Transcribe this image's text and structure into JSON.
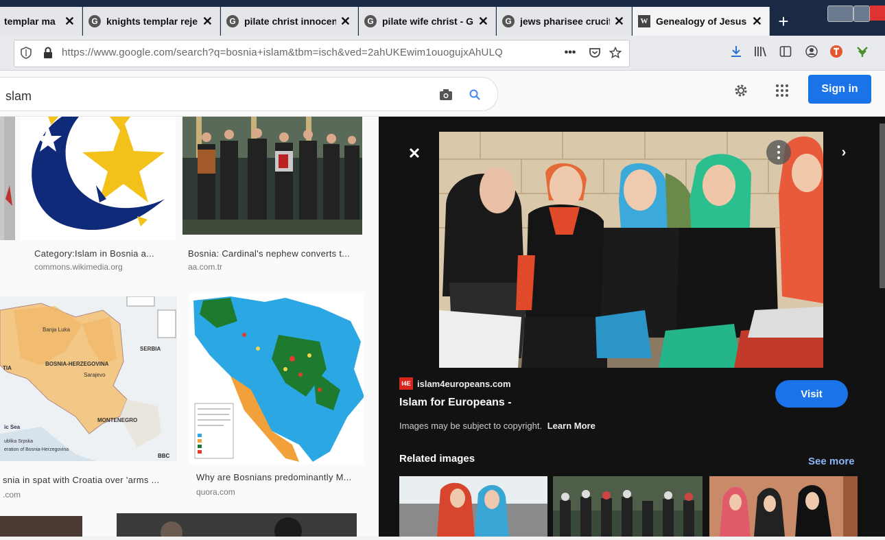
{
  "tabs": [
    {
      "title": "templar ma",
      "icon": "google-icon",
      "active": false
    },
    {
      "title": "knights templar reje",
      "icon": "google-icon",
      "active": false
    },
    {
      "title": "pilate christ innocen",
      "icon": "google-icon",
      "active": false
    },
    {
      "title": "pilate wife christ - G",
      "icon": "google-icon",
      "active": false
    },
    {
      "title": "jews pharisee crucif",
      "icon": "google-icon",
      "active": false
    },
    {
      "title": "Genealogy of Jesus -",
      "icon": "wikipedia-icon",
      "active": true
    }
  ],
  "new_tab": "+",
  "close_glyph": "✕",
  "address_bar": {
    "url": "https://www.google.com/search?q=bosnia+islam&tbm=isch&ved=2ahUKEwim1ouogujxAhULQ",
    "more": "•••"
  },
  "search": {
    "query": "slam"
  },
  "header": {
    "sign_in": "Sign in"
  },
  "results": [
    {
      "caption": "Category:Islam in Bosnia a...",
      "source": "commons.wikimedia.org"
    },
    {
      "caption": "Bosnia: Cardinal's nephew converts t...",
      "source": "aa.com.tr"
    },
    {
      "caption": "snia in spat with Croatia over 'arms ...",
      "source": ".com"
    },
    {
      "caption": "Why are Bosnians predominantly M...",
      "source": "quora.com"
    }
  ],
  "map_labels": {
    "banja_luka": "Banja Luka",
    "serbia": "SERBIA",
    "bih": "BOSNIA-HERZEGOVINA",
    "sarajevo": "Sarajevo",
    "montenegro": "MONTENEGRO",
    "tia": "TIA",
    "sea": "ic Sea",
    "srpska": "ublika Srpska",
    "federation": "eration of Bosnia-Herzegovina",
    "bbc": "BBC"
  },
  "viewer": {
    "source_badge": "I4E",
    "source_site": "islam4europeans.com",
    "title": "Islam for Europeans -",
    "visit": "Visit",
    "copyright": "Images may be subject to copyright.",
    "learn_more": "Learn More",
    "related_heading": "Related images",
    "see_more": "See more"
  },
  "colors": {
    "accent": "#1a73e8",
    "visit_button": "#1a73e8",
    "viewer_bg": "#121212",
    "tabbar_bg": "#1b2a44"
  }
}
